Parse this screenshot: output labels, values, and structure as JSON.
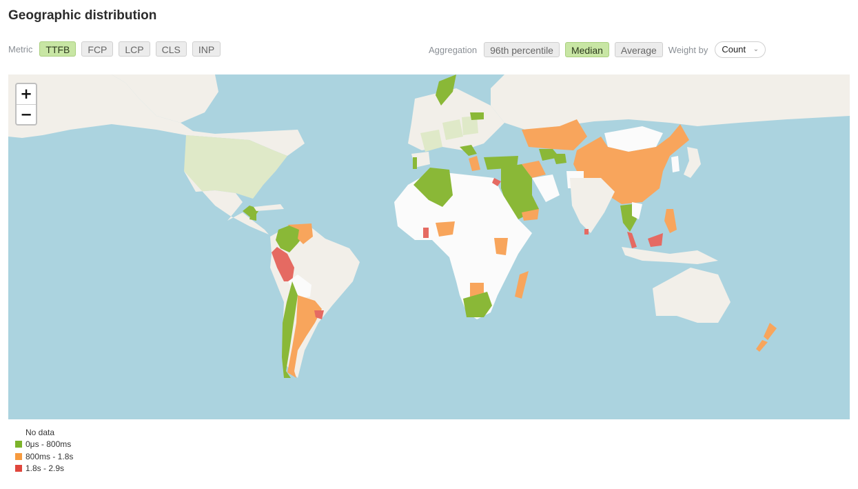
{
  "title": "Geographic distribution",
  "controls": {
    "metric_label": "Metric",
    "metrics": [
      "TTFB",
      "FCP",
      "LCP",
      "CLS",
      "INP"
    ],
    "metric_selected": "TTFB",
    "aggregation_label": "Aggregation",
    "aggregations": [
      "96th percentile",
      "Median",
      "Average"
    ],
    "aggregation_selected": "Median",
    "weight_label": "Weight by",
    "weight_value": "Count"
  },
  "map": {
    "zoom_in": "+",
    "zoom_out": "−",
    "colors": {
      "ocean": "#abd3df",
      "land": "#f2efe9",
      "no_data": "#fbfbfb",
      "light_green": "#dfe9c8",
      "green": "#8ab837",
      "orange": "#f8a55c",
      "red": "#e56a62"
    }
  },
  "legend": [
    {
      "label": "No data",
      "color": "#ffffff"
    },
    {
      "label": "0μs - 800ms",
      "color": "#7cb32a"
    },
    {
      "label": "800ms - 1.8s",
      "color": "#f79a3e"
    },
    {
      "label": "1.8s - 2.9s",
      "color": "#e0463c"
    }
  ]
}
